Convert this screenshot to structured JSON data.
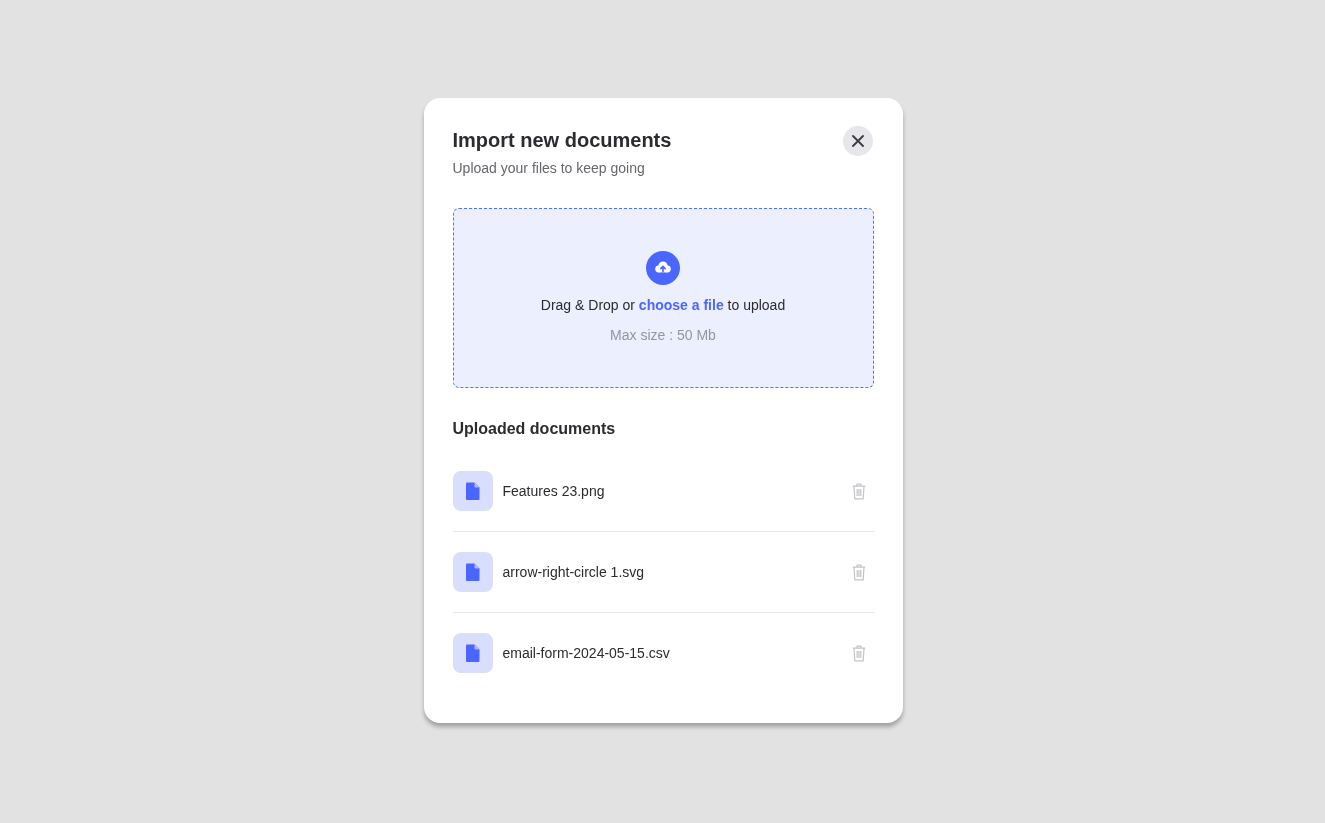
{
  "dialog": {
    "title": "Import new documents",
    "subtitle": "Upload your files to keep going"
  },
  "dropzone": {
    "prompt_before": "Drag & Drop or",
    "link": "choose a file",
    "prompt_after": "to upload",
    "hint": "Max size : 50 Mb"
  },
  "uploaded": {
    "title": "Uploaded documents",
    "documents": [
      {
        "name": "Features 23.png"
      },
      {
        "name": "arrow-right-circle 1.svg"
      },
      {
        "name": "email-form-2024-05-15.csv"
      }
    ]
  }
}
